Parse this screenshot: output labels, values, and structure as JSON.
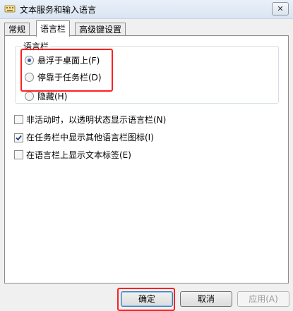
{
  "window": {
    "title": "文本服务和输入语言",
    "close_glyph": "✕"
  },
  "tabs": [
    {
      "label": "常规"
    },
    {
      "label": "语言栏"
    },
    {
      "label": "高级键设置"
    }
  ],
  "language_bar": {
    "group_label": "语言栏",
    "options": [
      {
        "label": "悬浮于桌面上(F)",
        "selected": true
      },
      {
        "label": "停靠于任务栏(D)",
        "selected": false
      },
      {
        "label": "隐藏(H)",
        "selected": false
      }
    ]
  },
  "checkboxes": [
    {
      "label": "非活动时，以透明状态显示语言栏(N)",
      "checked": false
    },
    {
      "label": "在任务栏中显示其他语言栏图标(I)",
      "checked": true
    },
    {
      "label": "在语言栏上显示文本标签(E)",
      "checked": false
    }
  ],
  "buttons": {
    "ok": "确定",
    "cancel": "取消",
    "apply": "应用(A)"
  },
  "colors": {
    "highlight": "#ff1f1f"
  },
  "icons": {
    "title": "keyboard-language-icon",
    "check": "checkmark-icon"
  }
}
